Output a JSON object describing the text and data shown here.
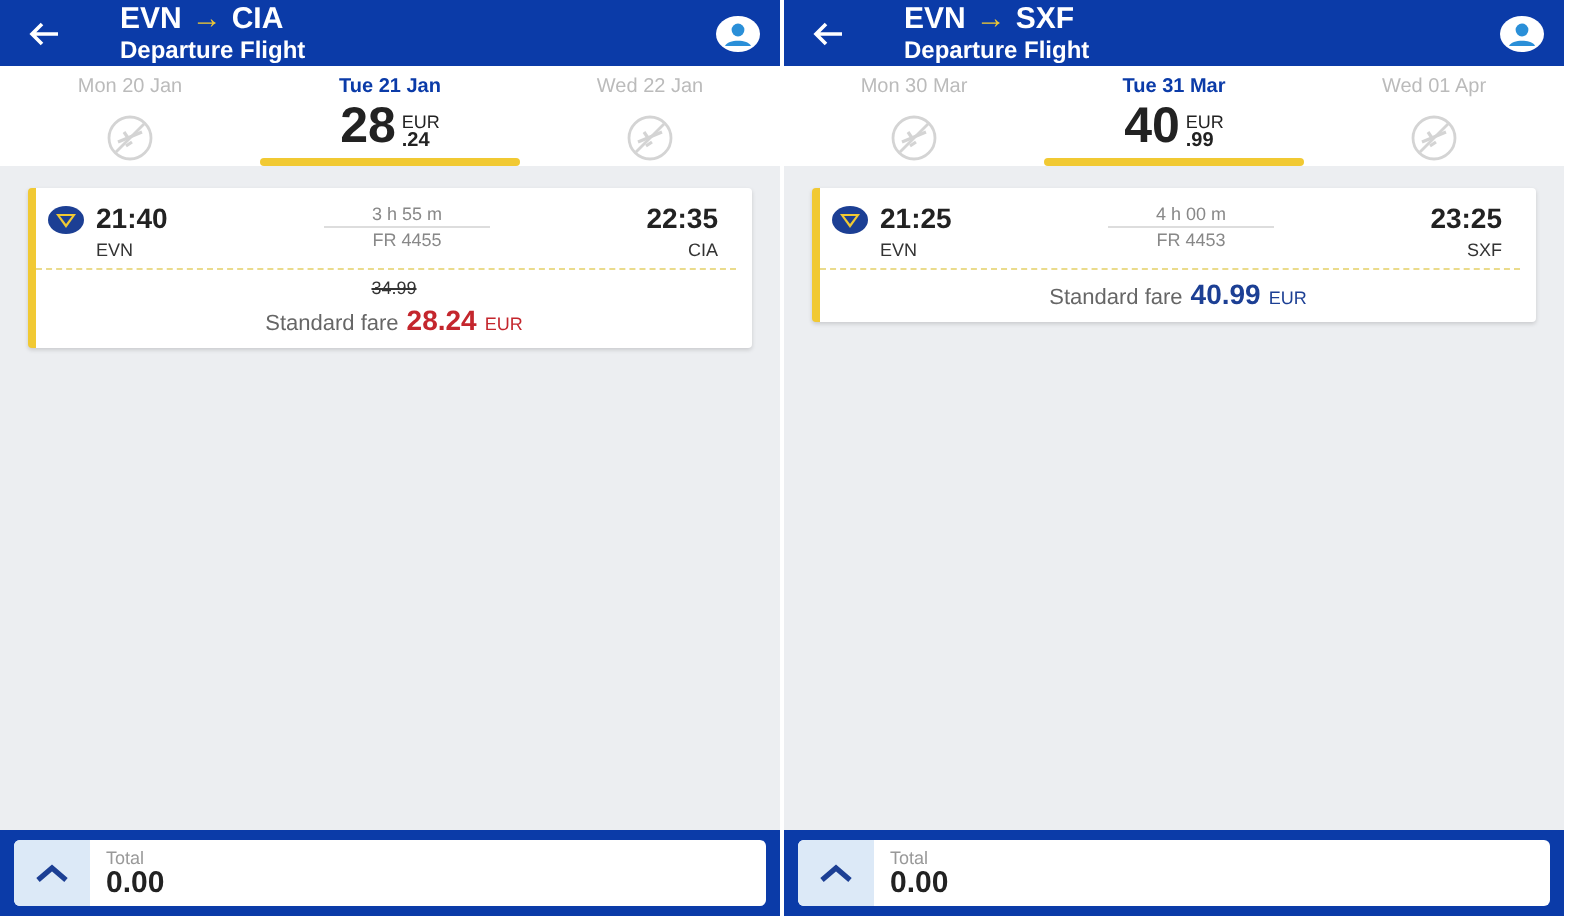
{
  "panels": [
    {
      "header": {
        "from": "EVN",
        "arrow": "→",
        "to": "CIA",
        "subtitle": "Departure Flight"
      },
      "dates": [
        {
          "label": "Mon 20 Jan",
          "selected": false
        },
        {
          "label": "Tue 21 Jan",
          "selected": true,
          "price": "28",
          "currency": "EUR",
          "cents": ".24"
        },
        {
          "label": "Wed 22 Jan",
          "selected": false
        }
      ],
      "flights": [
        {
          "dep_time": "21:40",
          "dep_airport": "EVN",
          "duration": "3 h 55 m",
          "flight_no": "FR 4455",
          "arr_time": "22:35",
          "arr_airport": "CIA",
          "old_price": "34.99",
          "fare_label": "Standard fare",
          "fare_price": "28.24",
          "fare_currency": "EUR",
          "discounted": true
        }
      ],
      "footer": {
        "label": "Total",
        "value": "0.00"
      }
    },
    {
      "header": {
        "from": "EVN",
        "arrow": "→",
        "to": "SXF",
        "subtitle": "Departure Flight"
      },
      "dates": [
        {
          "label": "Mon 30 Mar",
          "selected": false
        },
        {
          "label": "Tue 31 Mar",
          "selected": true,
          "price": "40",
          "currency": "EUR",
          "cents": ".99"
        },
        {
          "label": "Wed 01 Apr",
          "selected": false
        }
      ],
      "flights": [
        {
          "dep_time": "21:25",
          "dep_airport": "EVN",
          "duration": "4 h 00 m",
          "flight_no": "FR 4453",
          "arr_time": "23:25",
          "arr_airport": "SXF",
          "fare_label": "Standard fare",
          "fare_price": "40.99",
          "fare_currency": "EUR",
          "discounted": false
        }
      ],
      "footer": {
        "label": "Total",
        "value": "0.00"
      }
    }
  ]
}
